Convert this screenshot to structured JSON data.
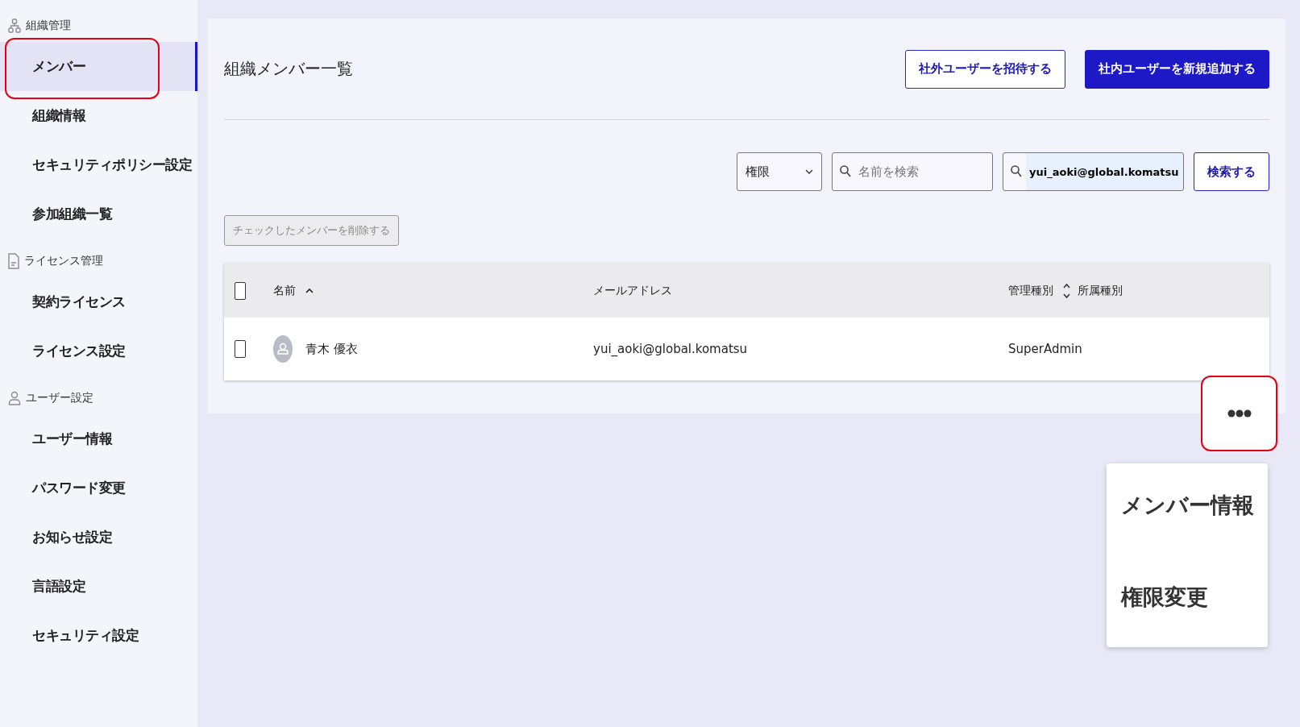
{
  "sidebar": {
    "sections": [
      {
        "title": "組織管理",
        "items": [
          {
            "label": "メンバー",
            "selected": true,
            "highlighted": true
          },
          {
            "label": "組織情報",
            "selected": false,
            "highlighted": false
          },
          {
            "label": "セキュリティポリシー設定",
            "selected": false,
            "highlighted": false
          },
          {
            "label": "参加組織一覧",
            "selected": false,
            "highlighted": false
          }
        ]
      },
      {
        "title": "ライセンス管理",
        "items": [
          {
            "label": "契約ライセンス",
            "selected": false,
            "highlighted": false
          },
          {
            "label": "ライセンス設定",
            "selected": false,
            "highlighted": false
          }
        ]
      },
      {
        "title": "ユーザー設定",
        "items": [
          {
            "label": "ユーザー情報",
            "selected": false,
            "highlighted": false
          },
          {
            "label": "パスワード変更",
            "selected": false,
            "highlighted": false
          },
          {
            "label": "お知らせ設定",
            "selected": false,
            "highlighted": false
          },
          {
            "label": "言語設定",
            "selected": false,
            "highlighted": false
          },
          {
            "label": "セキュリティ設定",
            "selected": false,
            "highlighted": false
          }
        ]
      }
    ]
  },
  "page": {
    "title": "組織メンバー一覧",
    "buttons": [
      {
        "label": "社外ユーザーを招待する",
        "kind": "outline"
      },
      {
        "label": "社内ユーザーを新規追加する",
        "kind": "primary"
      }
    ]
  },
  "filters": {
    "role_select": {
      "value": "権限"
    },
    "name_search": {
      "placeholder": "名前を検索"
    },
    "email_search": {
      "value": "yui_aoki@global.komatsu"
    },
    "search_button": "検索する"
  },
  "delete_button": {
    "label": "チェックしたメンバーを削除する",
    "disabled": true
  },
  "table": {
    "all_checked": false,
    "columns": [
      {
        "label": "名前",
        "kind": "ascending"
      },
      {
        "label": "メールアドレス",
        "kind": "plain"
      },
      {
        "label": "管理種別",
        "kind": "sortable"
      },
      {
        "label": "所属種別",
        "kind": "plain"
      }
    ],
    "rows": [
      {
        "checked": false,
        "name": "青木 優衣",
        "email": "yui_aoki@global.komatsu",
        "role": "SuperAdmin"
      }
    ]
  },
  "row_menu": {
    "more_highlighted": true,
    "open": true,
    "items": [
      "メンバー情報",
      "権限変更"
    ]
  }
}
